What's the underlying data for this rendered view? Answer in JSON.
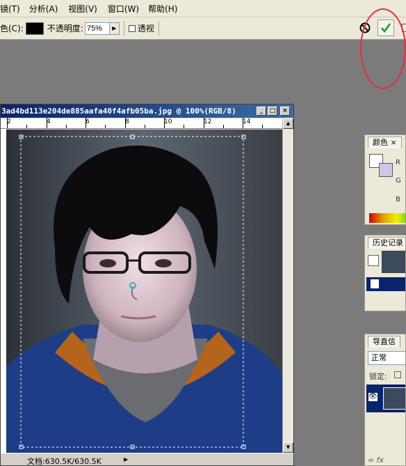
{
  "menubar": {
    "items": [
      "镜(T)",
      "分析(A)",
      "视图(V)",
      "窗口(W)",
      "帮助(H)"
    ]
  },
  "options": {
    "color_label": "色(C):",
    "opacity_label": "不透明度:",
    "opacity_value": "75%",
    "transparency_label": "透视",
    "swatch_color": "#000000"
  },
  "document": {
    "title": "3ad4bd113e204de885aafa40f4afb05ba.jpg @ 100%(RGB/8)",
    "ruler_labels": [
      "2",
      "4",
      "6",
      "8",
      "10",
      "12",
      "14"
    ],
    "status": "文档:630.5K/630.5K"
  },
  "panels": {
    "color_tab": "颜色",
    "channel_r": "R",
    "channel_g": "G",
    "channel_b": "B",
    "history_tab": "历史记录",
    "layers_tabs": "导直信",
    "blend_mode": "正常",
    "lock_label": "锁定:"
  },
  "colors": {
    "annotation": "#e0303a",
    "titlebar": "#0a246a",
    "commit_check": "#1f9a1f"
  }
}
